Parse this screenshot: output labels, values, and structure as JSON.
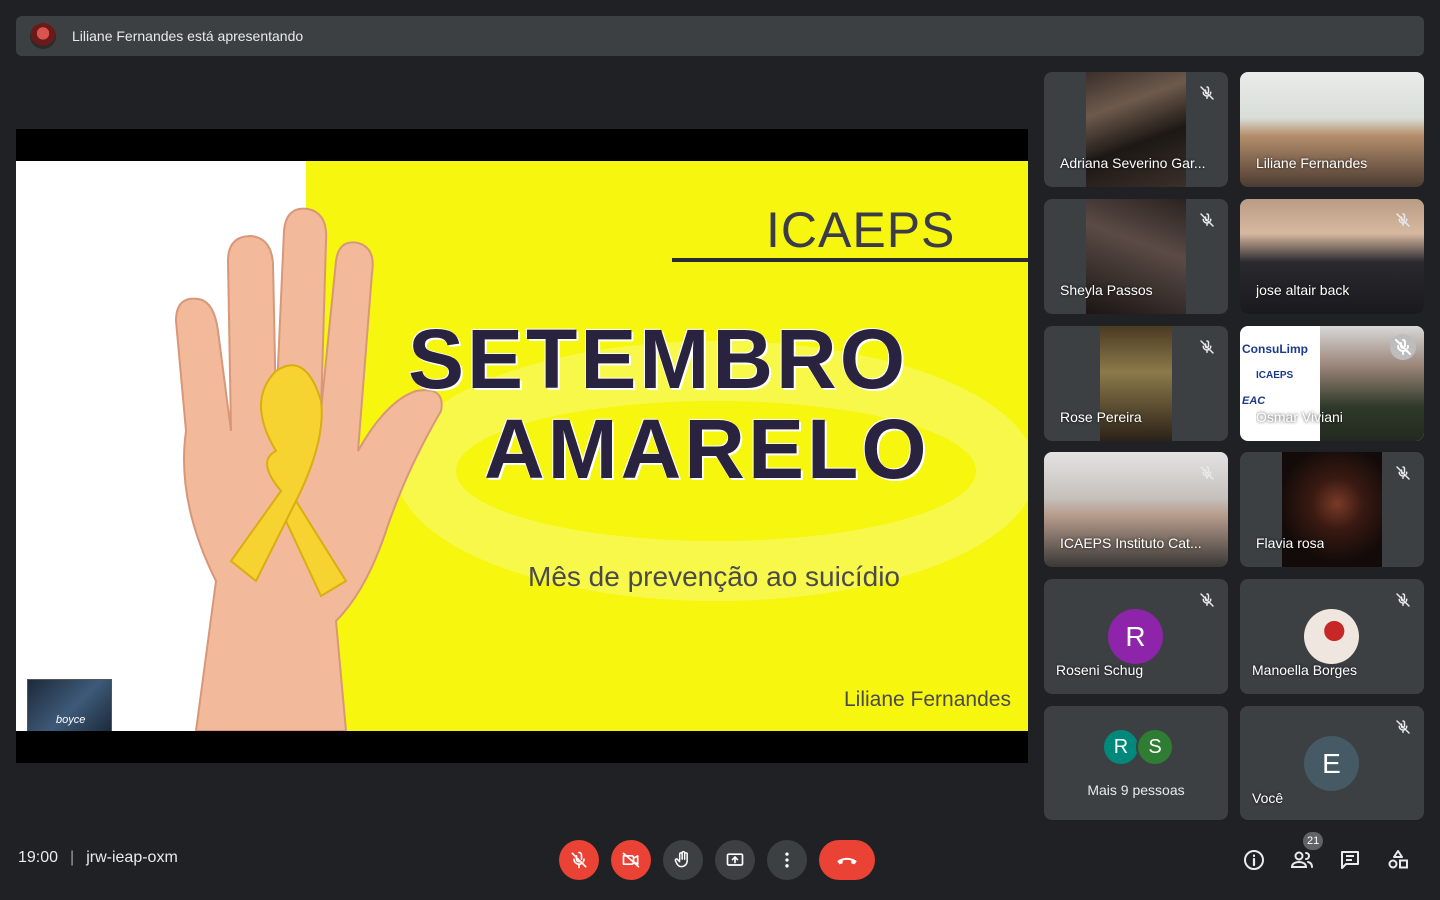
{
  "banner": {
    "text": "Liliane Fernandes está apresentando"
  },
  "slide": {
    "org": "ICAEPS",
    "title_line1": "SETEMBRO",
    "title_line2": "AMARELO",
    "subtitle": "Mês de prevenção ao suicídio",
    "author": "Liliane Fernandes",
    "mini_thumb_text": "boyce"
  },
  "tiles": [
    {
      "name": "Adriana Severino Gar..."
    },
    {
      "name": "Liliane Fernandes"
    },
    {
      "name": "Sheyla Passos"
    },
    {
      "name": "jose altair back"
    },
    {
      "name": "Rose Pereira"
    },
    {
      "name": "Osmar Viviani"
    },
    {
      "name": "ICAEPS Instituto Cat..."
    },
    {
      "name": "Flavia rosa"
    },
    {
      "name": "Roseni Schug",
      "letter": "R"
    },
    {
      "name": "Manoella Borges"
    },
    {
      "more_text": "Mais 9 pessoas",
      "letters": [
        "R",
        "S"
      ]
    },
    {
      "name": "Você",
      "letter": "E"
    }
  ],
  "osmar_logo": {
    "line1": "ConsuLimp",
    "line2": "ICAEPS",
    "line3": "EAC"
  },
  "meeting": {
    "time": "19:00",
    "separator": "|",
    "code": "jrw-ieap-oxm"
  },
  "participants_count": "21",
  "colors": {
    "end_call": "#ea4335",
    "avatar_purple": "#8e24aa",
    "avatar_teal": "#00897b",
    "avatar_green": "#2e7d32",
    "avatar_slate": "#455a64"
  }
}
